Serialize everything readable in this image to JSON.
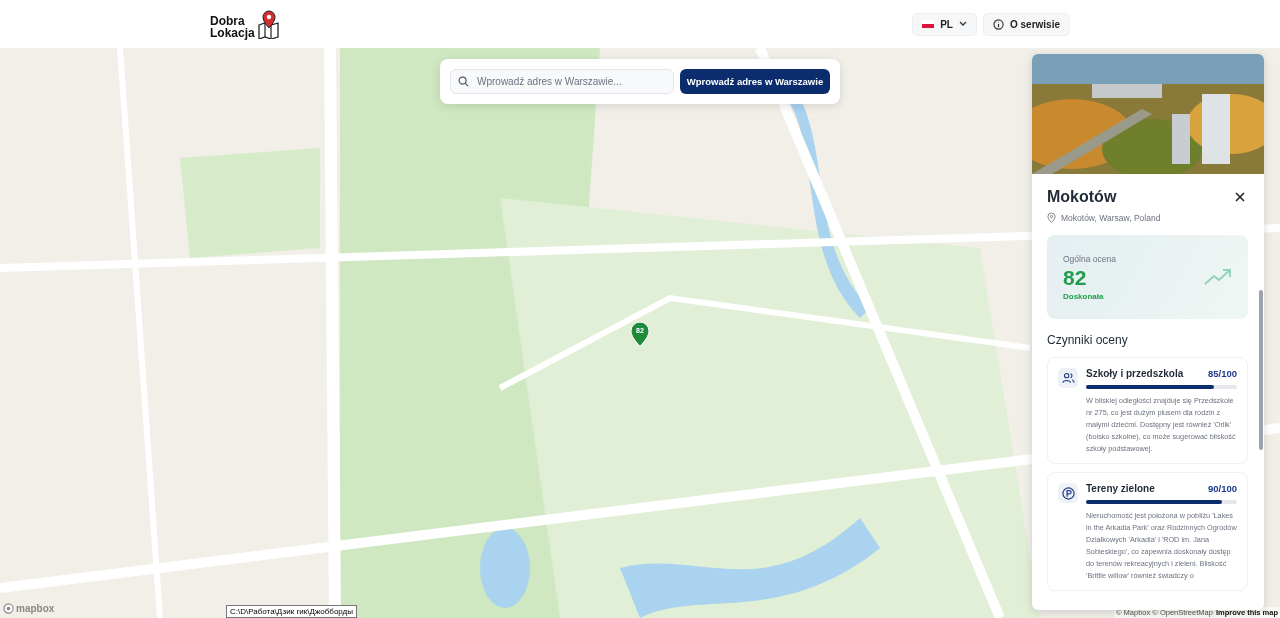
{
  "header": {
    "logo_lines": [
      "Dobra",
      "Lokacja"
    ],
    "language": "PL",
    "about": "O serwisie"
  },
  "search": {
    "placeholder": "Wprowadź adres w Warszawie...",
    "button": "Wprowadź adres w Warszawie"
  },
  "map": {
    "kind": "picture",
    "marker": "82",
    "mapbox_logo": "mapbox",
    "attribution": "© Mapbox © OpenStreetMap",
    "improve_link": "Improve this map",
    "tooltip": "C:\\D\\Работа\\Дзик гик\\Джобборды"
  },
  "panel": {
    "title": "Mokotów",
    "location": "Mokotów, Warsaw, Poland",
    "score": {
      "label": "Ogólna ocena",
      "value": "82",
      "rating": "Doskonała"
    },
    "section_title": "Czynniki oceny",
    "factors": [
      {
        "kind": "people",
        "name": "Szkoły i przedszkola",
        "score": "85/100",
        "level": 0.85,
        "description": "W bliskiej odległości znajduje się Przedszkole nr 275, co jest dużym plusem dla rodzin z małymi dziećmi. Dostępny jest również 'Orlik' (boisko szkolne), co może sugerować bliskość szkoły podstawowej."
      },
      {
        "kind": "parking",
        "name": "Tereny zielone",
        "score": "90/100",
        "level": 0.9,
        "description": "Nieruchomość jest położona w pobliżu 'Lakes in the Arkadia Park' oraz Rodzinnych Ogrodów Działkowych 'Arkadia' i 'ROD im. Jana Sobieskiego', co zapewnia doskonały dostęp do terenów rekreacyjnych i zieleni. Bliskość 'Brittle willow' również świadczy o"
      }
    ]
  }
}
